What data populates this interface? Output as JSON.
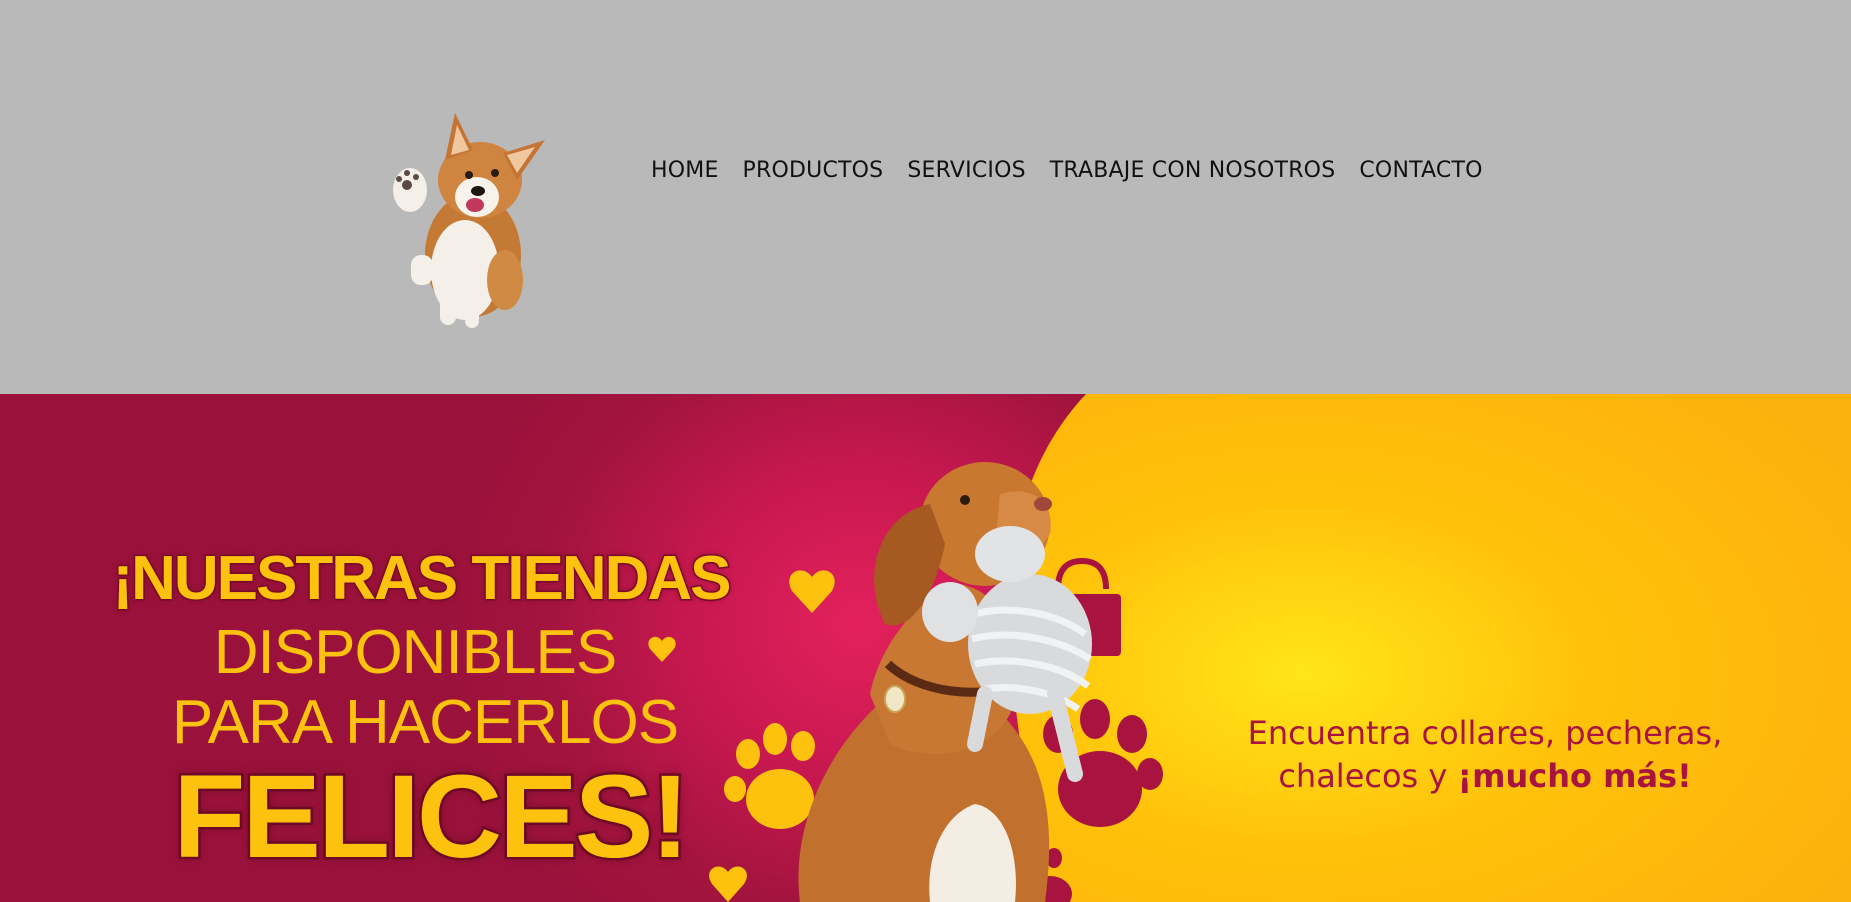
{
  "header": {
    "logo_alt": "corgi-logo",
    "nav": [
      {
        "label": "HOME"
      },
      {
        "label": "PRODUCTOS"
      },
      {
        "label": "SERVICIOS"
      },
      {
        "label": "TRABAJE CON NOSOTROS"
      },
      {
        "label": "CONTACTO"
      }
    ]
  },
  "banner": {
    "headline_line1": "¡NUESTRAS TIENDAS",
    "headline_line2": "DISPONIBLES",
    "headline_line3": "PARA HACERLOS",
    "headline_line4": "FELICES!",
    "tagline_line1": "Encuentra collares, pecheras,",
    "tagline_line2_prefix": "chalecos y ",
    "tagline_line2_highlight": "¡mucho más!"
  },
  "colors": {
    "header_bg": "#b9b9b9",
    "banner_magenta": "#a3143e",
    "banner_yellow": "#fcc20d",
    "accent_text": "#a8143f"
  }
}
